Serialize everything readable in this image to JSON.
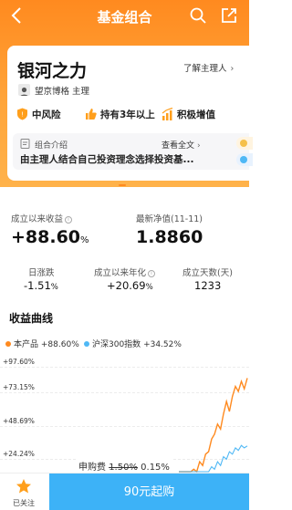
{
  "nav": {
    "title": "基金组合",
    "back_icon": "chevron-left-icon",
    "search_icon": "search-icon",
    "share_icon": "share-icon"
  },
  "portfolio": {
    "name": "银河之力",
    "manager_intro_link": "了解主理人",
    "manager_line": "望京博格 主理",
    "tags": [
      {
        "label": "中风险",
        "icon": "shield-icon"
      },
      {
        "label": "持有3年以上",
        "icon": "thumbs-up-icon"
      },
      {
        "label": "积极增值",
        "icon": "bar-chart-icon"
      }
    ],
    "intro": {
      "label": "组合介绍",
      "view_all": "查看全文",
      "text": "由主理人结合自己投资理念选择投资基..."
    }
  },
  "metrics": {
    "cumulative_return_label": "成立以来收益",
    "cumulative_return_value": "+88.60",
    "latest_nav_label": "最新净值(11-11)",
    "latest_nav_value": "1.8860",
    "daily_change_label": "日涨跌",
    "daily_change_value": "-1.51",
    "annualized_label": "成立以来年化",
    "annualized_value": "+20.69",
    "days_label": "成立天数(天)",
    "days_value": "1233",
    "percent_sign": "%"
  },
  "chart": {
    "section_title": "收益曲线",
    "legend": [
      {
        "name": "本产品",
        "value": "+88.60%",
        "color": "#ff8a1f"
      },
      {
        "name": "沪深300指数",
        "value": "+34.52%",
        "color": "#4fb8f5"
      }
    ],
    "y_ticks": [
      "+97.60%",
      "+73.15%",
      "+48.69%",
      "+24.24%"
    ]
  },
  "chart_data": {
    "type": "line",
    "title": "收益曲线",
    "ylim": [
      0,
      97.6
    ],
    "y_ticks": [
      24.24,
      48.69,
      73.15,
      97.6
    ],
    "series": [
      {
        "name": "本产品",
        "color": "#ff8a1f",
        "values": [
          2,
          6,
          4,
          12,
          9,
          16,
          14,
          22,
          19,
          28,
          30,
          40,
          44,
          52,
          48,
          60,
          70,
          62,
          74,
          82,
          78,
          86,
          80,
          88.6
        ]
      },
      {
        "name": "沪深300指数",
        "color": "#4fb8f5",
        "values": [
          1,
          3,
          2,
          6,
          4,
          8,
          6,
          10,
          8,
          13,
          12,
          18,
          16,
          22,
          19,
          26,
          24,
          30,
          28,
          33,
          31,
          35,
          33,
          34.52
        ]
      }
    ]
  },
  "fee": {
    "label": "申购费",
    "old_rate": "1.50%",
    "new_rate": "0.15%"
  },
  "bottom": {
    "follow_label": "已关注",
    "follow_icon": "star-icon",
    "buy_label": "90元起购",
    "brand_color": "#ff8a1f",
    "buy_color": "#3db2f7"
  }
}
